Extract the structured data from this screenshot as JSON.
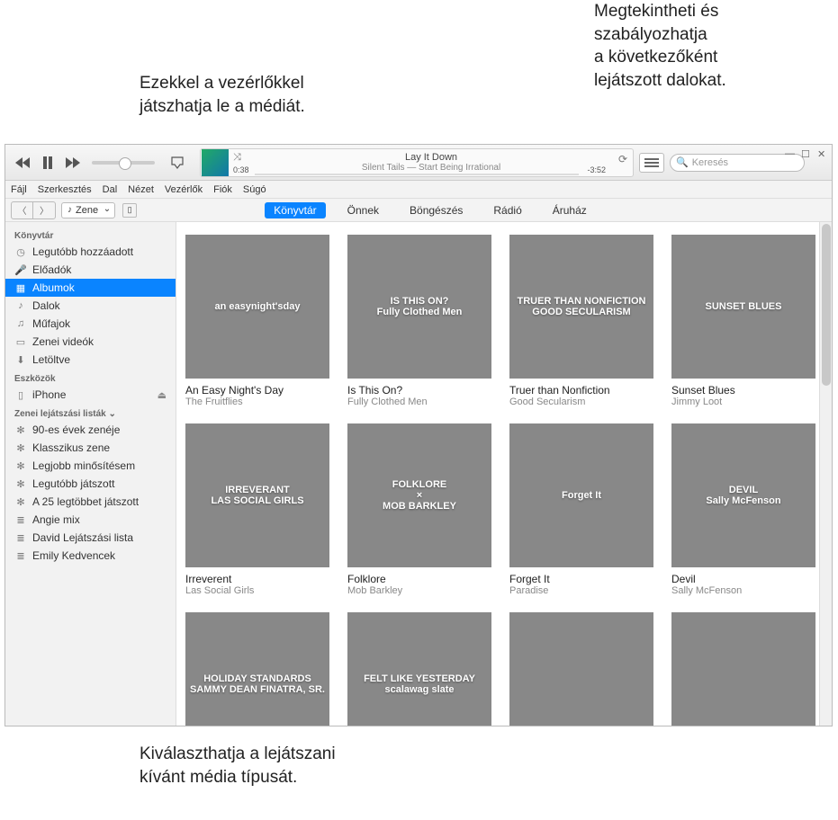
{
  "annotations": {
    "play": "Ezekkel a vezérlőkkel\njátszhatja le a médiát.",
    "upnext": "Megtekintheti és\nszabályozhatja\na következőként\nlejátszott dalokat.",
    "mediatype": "Kiválaszthatja a lejátszani\nkívánt média típusát."
  },
  "lcd": {
    "song": "Lay It Down",
    "artist": "Silent Tails — Start Being Irrational",
    "elapsed": "0:38",
    "remaining": "-3:52"
  },
  "search": {
    "placeholder": "Keresés"
  },
  "menubar": [
    "Fájl",
    "Szerkesztés",
    "Dal",
    "Nézet",
    "Vezérlők",
    "Fiók",
    "Súgó"
  ],
  "mediapicker": {
    "label": "Zene"
  },
  "tabs": [
    {
      "label": "Könyvtár",
      "active": true
    },
    {
      "label": "Önnek"
    },
    {
      "label": "Böngészés"
    },
    {
      "label": "Rádió"
    },
    {
      "label": "Áruház"
    }
  ],
  "sidebar": {
    "library_head": "Könyvtár",
    "library": [
      {
        "icon": "clock",
        "label": "Legutóbb hozzáadott"
      },
      {
        "icon": "mic",
        "label": "Előadók"
      },
      {
        "icon": "grid",
        "label": "Albumok",
        "selected": true
      },
      {
        "icon": "note",
        "label": "Dalok"
      },
      {
        "icon": "guitar",
        "label": "Műfajok"
      },
      {
        "icon": "video",
        "label": "Zenei videók"
      },
      {
        "icon": "down",
        "label": "Letöltve"
      }
    ],
    "devices_head": "Eszközök",
    "devices": [
      {
        "icon": "phone",
        "label": "iPhone",
        "eject": true
      }
    ],
    "playlists_head": "Zenei lejátszási listák",
    "playlists": [
      {
        "icon": "gear",
        "label": "90-es évek zenéje"
      },
      {
        "icon": "gear",
        "label": "Klasszikus zene"
      },
      {
        "icon": "gear",
        "label": "Legjobb minősítésem"
      },
      {
        "icon": "gear",
        "label": "Legutóbb játszott"
      },
      {
        "icon": "gear",
        "label": "A 25 legtöbbet játszott"
      },
      {
        "icon": "list",
        "label": "Angie mix"
      },
      {
        "icon": "list",
        "label": "David Lejátszási lista"
      },
      {
        "icon": "list",
        "label": "Emily Kedvencek"
      }
    ]
  },
  "albums": [
    {
      "title": "An Easy Night's Day",
      "artist": "The Fruitflies",
      "cover": "an easynight'sday"
    },
    {
      "title": "Is This On?",
      "artist": "Fully Clothed Men",
      "cover": "IS THIS ON?\nFully Clothed Men"
    },
    {
      "title": "Truer than Nonfiction",
      "artist": "Good Secularism",
      "cover": "TRUER THAN NONFICTION\nGOOD SECULARISM"
    },
    {
      "title": "Sunset Blues",
      "artist": "Jimmy Loot",
      "cover": "SUNSET BLUES"
    },
    {
      "title": "Irreverent",
      "artist": "Las Social Girls",
      "cover": "IRREVERANT\nLAS SOCIAL GIRLS"
    },
    {
      "title": "Folklore",
      "artist": "Mob Barkley",
      "cover": "FOLKLORE\n×\nMOB BARKLEY"
    },
    {
      "title": "Forget It",
      "artist": "Paradise",
      "cover": "Forget It"
    },
    {
      "title": "Devil",
      "artist": "Sally McFenson",
      "cover": "DEVIL\nSally McFenson"
    },
    {
      "title": "",
      "artist": "",
      "cover": "HOLIDAY STANDARDS\nSAMMY DEAN FINATRA, SR."
    },
    {
      "title": "",
      "artist": "",
      "cover": "FELT LIKE YESTERDAY\nscalawag slate"
    },
    {
      "title": "",
      "artist": "",
      "cover": ""
    },
    {
      "title": "",
      "artist": "",
      "cover": ""
    }
  ],
  "icons": {
    "clock": "◷",
    "mic": "🎤",
    "grid": "▦",
    "note": "♪",
    "guitar": "♫",
    "video": "▭",
    "down": "⬇",
    "phone": "▯",
    "gear": "✻",
    "list": "≣"
  }
}
